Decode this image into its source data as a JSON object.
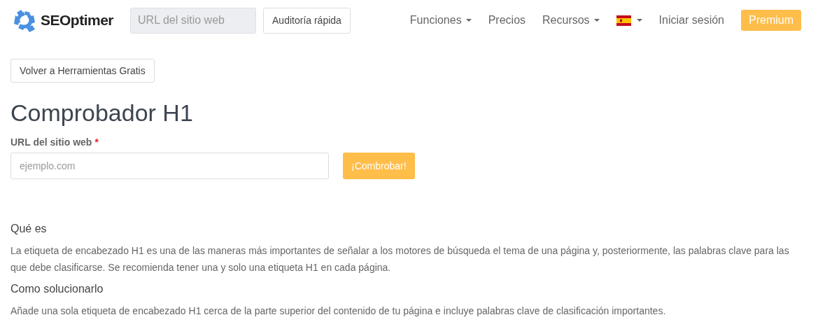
{
  "navbar": {
    "logo": "SEOptimer",
    "search_placeholder": "URL del sitio web",
    "audit_button": "Auditoría rápida",
    "links": [
      {
        "label": "Funciones",
        "dropdown": true
      },
      {
        "label": "Precios",
        "dropdown": false
      },
      {
        "label": "Recursos",
        "dropdown": true
      }
    ],
    "language": {
      "dropdown": true
    },
    "login": "Iniciar sesión",
    "premium": "Premium"
  },
  "back_button": "Volver a Herramientas Gratis",
  "title": "Comprobador H1",
  "form": {
    "label": "URL del sitio web",
    "required_mark": "*",
    "placeholder": "ejemplo.com",
    "submit": "¡Combrobar!"
  },
  "sections": [
    {
      "heading": "Qué es",
      "text": "La etiqueta de encabezado H1 es una de las maneras más importantes de señalar a los motores de búsqueda el tema de una página y, posteriormente, las palabras clave para las que debe clasificarse. Se recomienda tener una y solo una etiqueta H1 en cada página."
    },
    {
      "heading": "Como solucionarlo",
      "text": "Añade una sola etiqueta de encabezado H1 cerca de la parte superior del contenido de tu página e incluye palabras clave de clasificación importantes."
    }
  ]
}
